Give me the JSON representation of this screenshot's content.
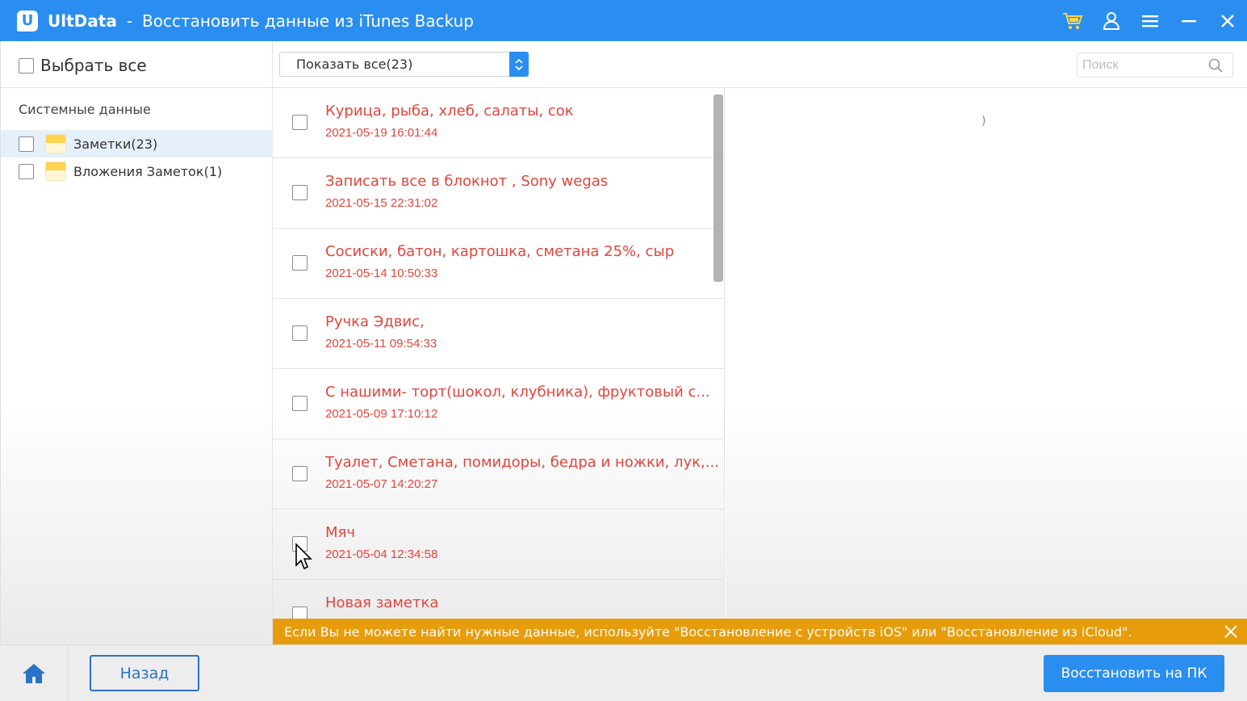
{
  "window": {
    "app_name": "UltData",
    "separator": "-",
    "title": "Восстановить данные из iTunes Backup",
    "logo_letter": "U",
    "accent_color": "#2a8ef0",
    "icons": [
      "cart-icon",
      "user-icon",
      "menu-icon",
      "minimize-icon",
      "close-icon"
    ]
  },
  "sidebar": {
    "select_all_label": "Выбрать все",
    "section_title": "Системные данные",
    "items": [
      {
        "label": "Заметки(23)",
        "icon": "notes-icon",
        "active": true
      },
      {
        "label": "Вложения Заметок(1)",
        "icon": "notes-icon",
        "active": false
      }
    ]
  },
  "toolbar": {
    "filter_value": "Показать все(23)",
    "search_placeholder": "Поиск"
  },
  "notes": [
    {
      "title": "Курица, рыба, хлеб, салаты, сок",
      "date": "2021-05-19 16:01:44"
    },
    {
      "title": "Записать все в блокнот , Sony wegas",
      "date": "2021-05-15 22:31:02"
    },
    {
      "title": "Сосиски, батон, картошка, сметана 25%, сыр",
      "date": "2021-05-14 10:50:33"
    },
    {
      "title": "Ручка Эдвис,",
      "date": "2021-05-11 09:54:33"
    },
    {
      "title": "С нашими- торт(шокол, клубника), фруктовый с...",
      "date": "2021-05-09 17:10:12"
    },
    {
      "title": "Туалет, Сметана, помидоры, бедра и ножки, лук,...",
      "date": "2021-05-07 14:20:27"
    },
    {
      "title": "Мяч",
      "date": "2021-05-04 12:34:58"
    },
    {
      "title": "Новая заметка",
      "date": ""
    }
  ],
  "preview": {
    "mark": ")"
  },
  "notice": {
    "text": "Если Вы не можете найти нужные данные, используйте \"Восстановление с устройств iOS\" или \"Восстановление из iCloud\".",
    "color": "#e79c0b"
  },
  "bottom": {
    "back_label": "Назад",
    "recover_label": "Восстановить на ПК"
  }
}
